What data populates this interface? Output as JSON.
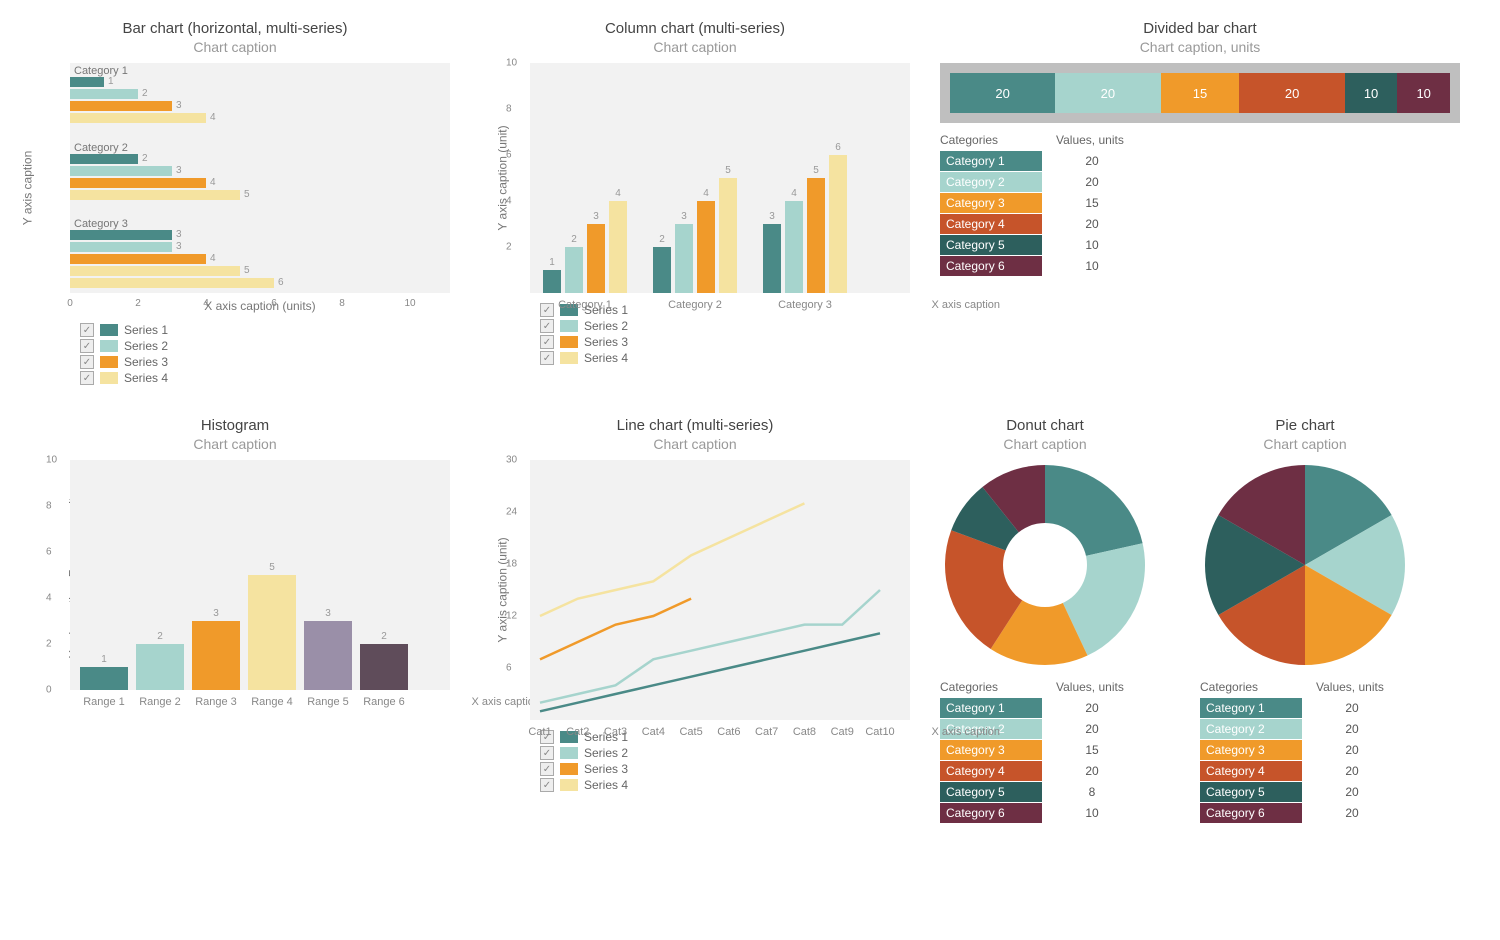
{
  "colors": {
    "teal": "#4a8a87",
    "lightteal": "#a6d4cd",
    "orange": "#f09a2a",
    "cream": "#f5e3a0",
    "rust": "#c6542a",
    "darkteal": "#2d5f5d",
    "maroon": "#6e2f44",
    "mauve": "#9a8fa8",
    "plum": "#5f4c5a"
  },
  "chart_data": [
    {
      "id": "hbar",
      "type": "bar-horizontal",
      "title": "Bar chart (horizontal, multi-series)",
      "caption": "Chart caption",
      "xlabel": "X axis caption (units)",
      "ylabel": "Y axis caption",
      "xlim": [
        0,
        10
      ],
      "xticks": [
        0,
        2,
        4,
        6,
        8,
        10
      ],
      "categories": [
        "Category 1",
        "Category 2",
        "Category 3"
      ],
      "series": [
        {
          "name": "Series 1",
          "color": "teal",
          "values": [
            1,
            2,
            3
          ]
        },
        {
          "name": "Series 2",
          "color": "lightteal",
          "values": [
            2,
            3,
            3
          ]
        },
        {
          "name": "Series 3",
          "color": "orange",
          "values": [
            3,
            4,
            4
          ]
        },
        {
          "name": "Series 4",
          "color": "cream",
          "values": [
            4,
            5,
            5
          ]
        }
      ],
      "labels": [
        [
          1,
          2,
          3,
          4
        ],
        [
          2,
          3,
          4,
          5
        ],
        [
          3,
          3,
          4,
          5,
          6
        ]
      ]
    },
    {
      "id": "column",
      "type": "bar",
      "title": "Column chart (multi-series)",
      "caption": "Chart caption",
      "xlabel": "X axis caption",
      "ylabel": "Y axis caption (unit)",
      "ylim": [
        0,
        10
      ],
      "yticks": [
        2,
        4,
        6,
        8,
        10
      ],
      "categories": [
        "Category 1",
        "Category 2",
        "Category 3"
      ],
      "series": [
        {
          "name": "Series 1",
          "color": "teal",
          "values": [
            1,
            2,
            3
          ]
        },
        {
          "name": "Series 2",
          "color": "lightteal",
          "values": [
            2,
            3,
            4
          ]
        },
        {
          "name": "Series 3",
          "color": "orange",
          "values": [
            3,
            4,
            5
          ]
        },
        {
          "name": "Series 4",
          "color": "cream",
          "values": [
            4,
            5,
            6
          ]
        }
      ]
    },
    {
      "id": "divided",
      "type": "stacked-single",
      "title": "Divided bar chart",
      "caption": "Chart caption, units",
      "table_head_cat": "Categories",
      "table_head_val": "Values, units",
      "segments": [
        {
          "label": "Category 1",
          "value": 20,
          "color": "teal"
        },
        {
          "label": "Category 2",
          "value": 20,
          "color": "lightteal"
        },
        {
          "label": "Category 3",
          "value": 15,
          "color": "orange"
        },
        {
          "label": "Category 4",
          "value": 20,
          "color": "rust"
        },
        {
          "label": "Category 5",
          "value": 10,
          "color": "darkteal"
        },
        {
          "label": "Category 6",
          "value": 10,
          "color": "maroon"
        }
      ]
    },
    {
      "id": "histogram",
      "type": "bar",
      "title": "Histogram",
      "caption": "Chart caption",
      "xlabel": "X axis caption",
      "ylabel": "Y axis caption, Frequency units",
      "ylim": [
        0,
        10
      ],
      "yticks": [
        0,
        2,
        4,
        6,
        8,
        10
      ],
      "categories": [
        "Range 1",
        "Range 2",
        "Range 3",
        "Range 4",
        "Range 5",
        "Range 6"
      ],
      "values": [
        1,
        2,
        3,
        5,
        3,
        2
      ],
      "bar_colors": [
        "teal",
        "lightteal",
        "orange",
        "cream",
        "mauve",
        "plum"
      ]
    },
    {
      "id": "line",
      "type": "line",
      "title": "Line chart (multi-series)",
      "caption": "Chart caption",
      "xlabel": "X axis caption",
      "ylabel": "Y axis caption (unit)",
      "ylim": [
        0,
        30
      ],
      "yticks": [
        6,
        12,
        18,
        24,
        30
      ],
      "x": [
        "Cat1",
        "Cat2",
        "Cat3",
        "Cat4",
        "Cat5",
        "Cat6",
        "Cat7",
        "Cat8",
        "Cat9",
        "Cat10"
      ],
      "series": [
        {
          "name": "Series 1",
          "color": "teal",
          "values": [
            1,
            2,
            3,
            4,
            5,
            6,
            7,
            8,
            9,
            10
          ]
        },
        {
          "name": "Series 2",
          "color": "lightteal",
          "values": [
            2,
            3,
            4,
            7,
            8,
            9,
            10,
            11,
            11,
            15
          ]
        },
        {
          "name": "Series 3",
          "color": "orange",
          "values": [
            7,
            9,
            11,
            12,
            14,
            null,
            null,
            null,
            null,
            null
          ]
        },
        {
          "name": "Series 4",
          "color": "cream",
          "values": [
            12,
            14,
            15,
            16,
            19,
            21,
            23,
            25,
            null,
            null
          ]
        }
      ]
    },
    {
      "id": "donut",
      "type": "donut",
      "title": "Donut chart",
      "caption": "Chart caption",
      "table_head_cat": "Categories",
      "table_head_val": "Values, units",
      "segments": [
        {
          "label": "Category 1",
          "value": 20,
          "color": "teal"
        },
        {
          "label": "Category 2",
          "value": 20,
          "color": "lightteal"
        },
        {
          "label": "Category 3",
          "value": 15,
          "color": "orange"
        },
        {
          "label": "Category 4",
          "value": 20,
          "color": "rust"
        },
        {
          "label": "Category 5",
          "value": 8,
          "color": "darkteal"
        },
        {
          "label": "Category 6",
          "value": 10,
          "color": "maroon"
        }
      ]
    },
    {
      "id": "pie",
      "type": "pie",
      "title": "Pie chart",
      "caption": "Chart caption",
      "table_head_cat": "Categories",
      "table_head_val": "Values, units",
      "segments": [
        {
          "label": "Category 1",
          "value": 20,
          "color": "teal"
        },
        {
          "label": "Category 2",
          "value": 20,
          "color": "lightteal"
        },
        {
          "label": "Category 3",
          "value": 20,
          "color": "orange"
        },
        {
          "label": "Category 4",
          "value": 20,
          "color": "rust"
        },
        {
          "label": "Category 5",
          "value": 20,
          "color": "darkteal"
        },
        {
          "label": "Category 6",
          "value": 20,
          "color": "maroon"
        }
      ]
    }
  ],
  "legend_series": [
    "Series 1",
    "Series 2",
    "Series 3",
    "Series 4"
  ]
}
